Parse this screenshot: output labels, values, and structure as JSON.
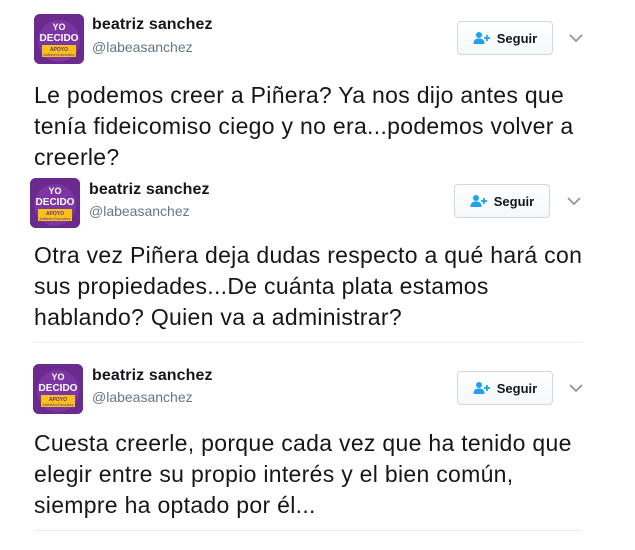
{
  "tweets": [
    {
      "author_name": "beatriz sanchez",
      "author_handle": "@labeasanchez",
      "follow_label": "Seguir",
      "avatar_text": [
        "YO",
        "DECIDO",
        "APOYO",
        "#albertoGonzález"
      ],
      "text": "Le podemos creer a Piñera? Ya nos dijo antes que tenía fideicomiso ciego y no era...podemos volver a creerle?"
    },
    {
      "author_name": "beatriz sanchez",
      "author_handle": "@labeasanchez",
      "follow_label": "Seguir",
      "avatar_text": [
        "YO",
        "DECIDO",
        "APOYO",
        "#albertoGonzález"
      ],
      "text": "Otra vez Piñera deja dudas respecto a qué hará con sus propiedades...De cuánta plata estamos hablando? Quien va a administrar?"
    },
    {
      "author_name": "beatriz sanchez",
      "author_handle": "@labeasanchez",
      "follow_label": "Seguir",
      "avatar_text": [
        "YO",
        "DECIDO",
        "APOYO",
        "#albertoGonzález"
      ],
      "text": "Cuesta creerle, porque cada vez que ha tenido que elegir entre su propio interés y el bien común, siempre ha optado por él..."
    }
  ],
  "colors": {
    "avatar_purple": "#6b2a8e",
    "avatar_yellow": "#f6c21a",
    "handle_gray": "#657786",
    "follow_icon_blue": "#1da1f2",
    "divider": "#e6ecf0"
  },
  "icons": {
    "follow": "person-plus-icon",
    "more": "chevron-down-icon"
  }
}
